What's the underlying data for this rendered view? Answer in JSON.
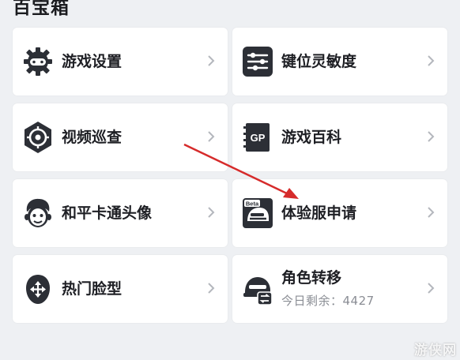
{
  "section": {
    "title": "百宝箱"
  },
  "items": [
    {
      "label": "游戏设置",
      "icon": "gear-controller-icon"
    },
    {
      "label": "键位灵敏度",
      "icon": "sliders-icon"
    },
    {
      "label": "视频巡查",
      "icon": "crosshair-icon"
    },
    {
      "label": "游戏百科",
      "icon": "gp-book-icon"
    },
    {
      "label": "和平卡通头像",
      "icon": "cartoon-face-icon"
    },
    {
      "label": "体验服申请",
      "icon": "beta-helmet-icon",
      "badge": "Beta"
    },
    {
      "label": "热门脸型",
      "icon": "face-shape-icon"
    },
    {
      "label": "角色转移",
      "sublabel": "今日剩余：4427",
      "icon": "character-transfer-icon"
    }
  ],
  "colors": {
    "icon_dark": "#2c2f36",
    "arrow": "#d62b2b",
    "background": "#eef0f3",
    "card": "#ffffff"
  },
  "watermark": "游侠网"
}
